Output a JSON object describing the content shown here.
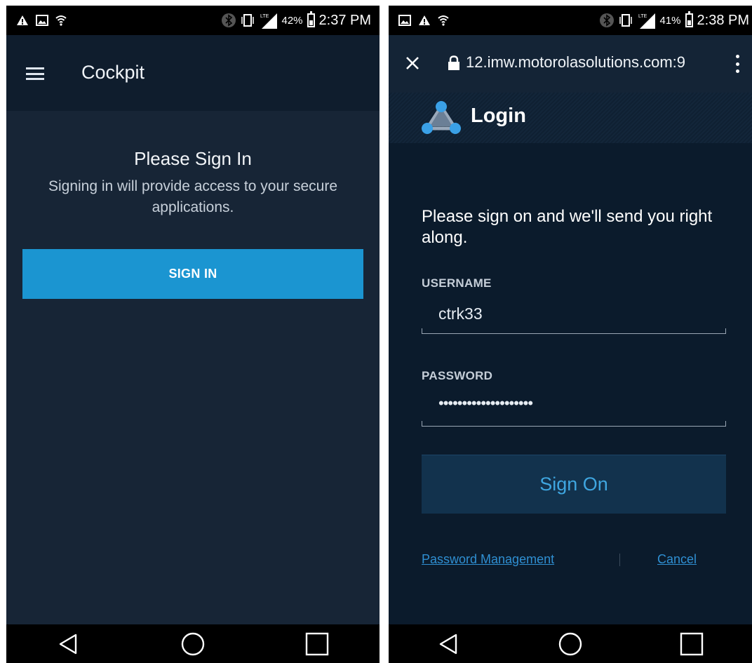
{
  "left_screen": {
    "status_bar": {
      "left_icons": [
        "warning-icon",
        "image-icon",
        "wifi-icon"
      ],
      "right_icons": [
        "bluetooth-icon",
        "vibrate-icon",
        "lte-signal-icon",
        "battery-icon"
      ],
      "network_label": "LTE",
      "battery_percent": "42%",
      "battery_level": 0.42,
      "time": "2:37 PM"
    },
    "app_bar": {
      "menu_icon": "hamburger-menu-icon",
      "title": "Cockpit"
    },
    "main": {
      "heading": "Please Sign In",
      "subtitle": "Signing in will provide access to your secure applications.",
      "sign_in_button": "SIGN IN",
      "button_color": "#1b95d1"
    },
    "nav_bar": [
      "back-icon",
      "home-icon",
      "recents-icon"
    ]
  },
  "right_screen": {
    "status_bar": {
      "left_icons": [
        "image-icon",
        "warning-icon",
        "wifi-icon"
      ],
      "right_icons": [
        "bluetooth-icon",
        "vibrate-icon",
        "lte-signal-icon",
        "battery-icon"
      ],
      "network_label": "LTE",
      "battery_percent": "41%",
      "battery_level": 0.41,
      "time": "2:38 PM"
    },
    "browser_bar": {
      "close_icon": "close-icon",
      "lock_icon": "lock-icon",
      "url": "12.imw.motorolasolutions.com:9",
      "menu_icon": "kebab-menu-icon"
    },
    "header": {
      "logo": "triangle-network-logo",
      "title": "Login"
    },
    "form": {
      "intro": "Please sign on and we'll send you right along.",
      "username_label": "USERNAME",
      "username_value": "ctrk33",
      "password_label": "PASSWORD",
      "password_value": "••••••••••••••••••••",
      "sign_on_button": "Sign On",
      "button_text_color": "#3fa6e0",
      "password_management_link": "Password Management",
      "cancel_link": "Cancel"
    },
    "nav_bar": [
      "back-icon",
      "home-icon",
      "recents-icon"
    ]
  }
}
